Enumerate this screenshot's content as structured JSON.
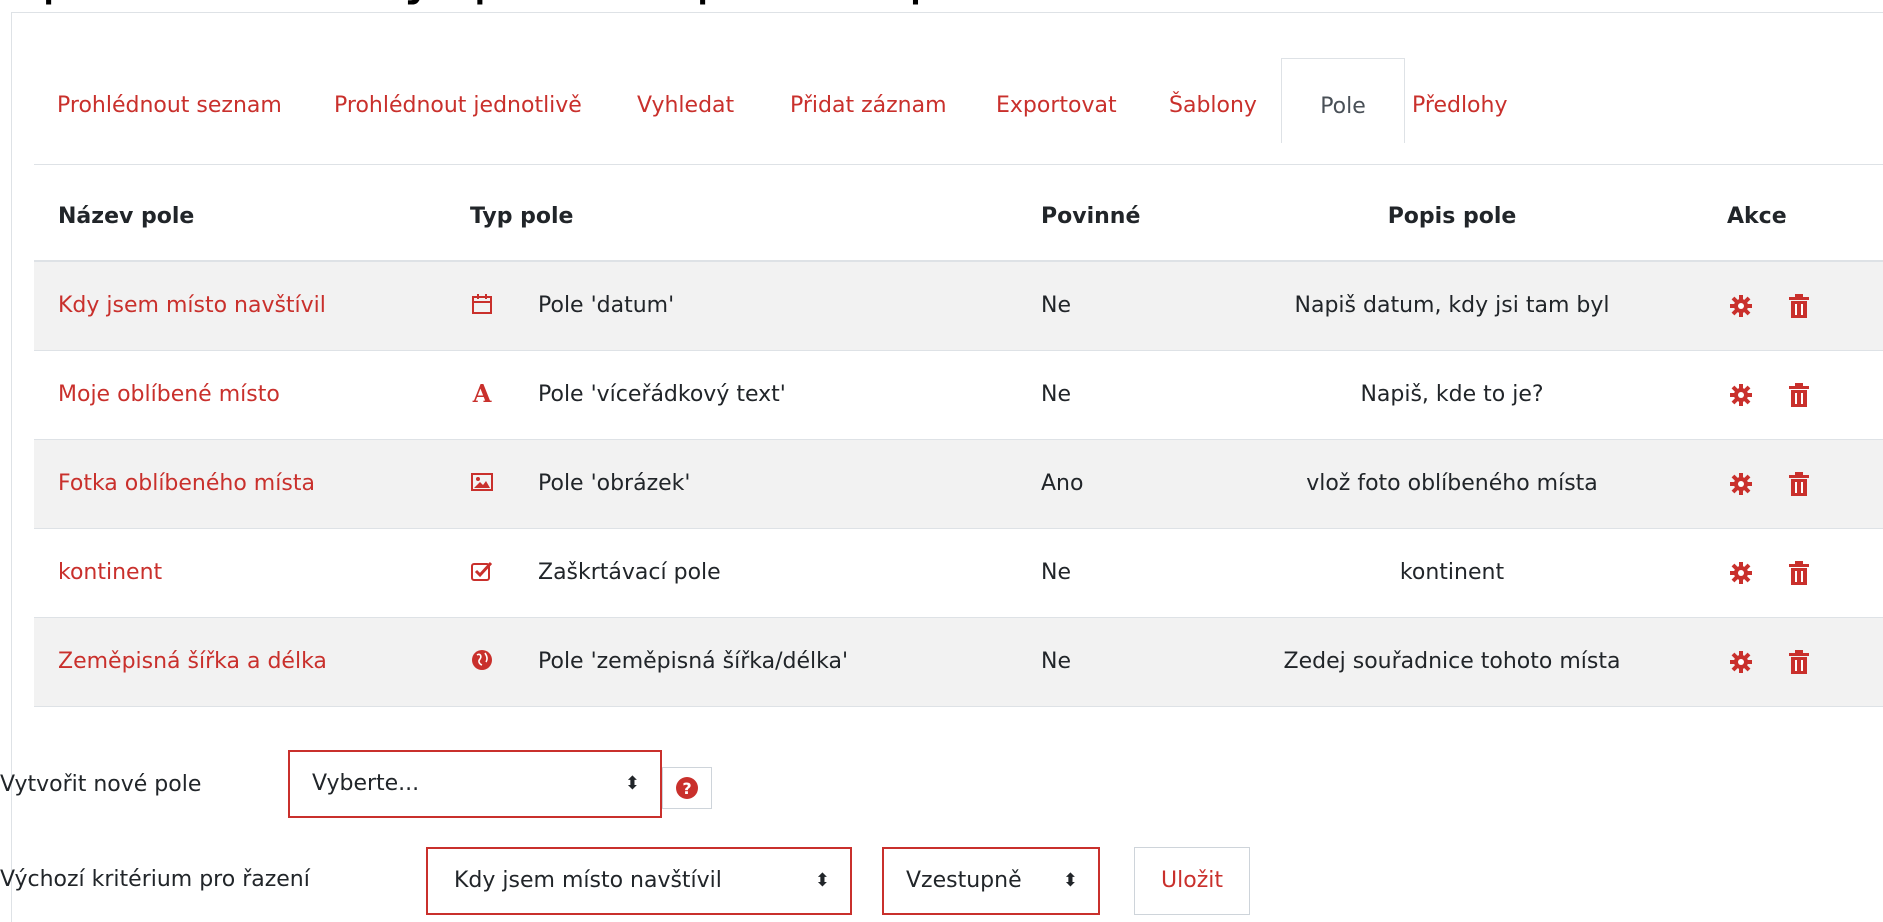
{
  "page_title_partial": "Úprava šablony, pomocí přidání polí",
  "tabs": [
    {
      "label": "Prohlédnout seznam"
    },
    {
      "label": "Prohlédnout jednotlivě"
    },
    {
      "label": "Vyhledat"
    },
    {
      "label": "Přidat záznam"
    },
    {
      "label": "Exportovat"
    },
    {
      "label": "Šablony"
    },
    {
      "label": "Pole",
      "active": true
    },
    {
      "label": "Předlohy"
    }
  ],
  "table": {
    "headers": {
      "name": "Název pole",
      "type": "Typ pole",
      "required": "Povinné",
      "description": "Popis pole",
      "actions": "Akce"
    },
    "rows": [
      {
        "name": "Kdy jsem místo navštívil",
        "type_icon": "calendar-icon",
        "type": "Pole 'datum'",
        "required": "Ne",
        "description": "Napiš datum, kdy jsi tam byl"
      },
      {
        "name": "Moje oblíbené místo",
        "type_icon": "text-font-icon",
        "type": "Pole 'víceřádkový text'",
        "required": "Ne",
        "description": "Napiš, kde to je?"
      },
      {
        "name": "Fotka oblíbeného místa",
        "type_icon": "image-icon",
        "type": "Pole 'obrázek'",
        "required": "Ano",
        "description": "vlož foto oblíbeného místa"
      },
      {
        "name": "kontinent",
        "type_icon": "checkbox-icon",
        "type": "Zaškrtávací pole",
        "required": "Ne",
        "description": "kontinent"
      },
      {
        "name": "Zeměpisná šířka a délka",
        "type_icon": "globe-icon",
        "type": "Pole 'zeměpisná šířka/délka'",
        "required": "Ne",
        "description": "Zedej souřadnice tohoto místa"
      }
    ],
    "action_icons": [
      "gear-icon",
      "trash-icon"
    ]
  },
  "new_field": {
    "label": "Vytvořit nové pole",
    "select_value": "Vyberte...",
    "help_icon": "question-circle-icon"
  },
  "sorting": {
    "label": "Výchozí kritérium pro řazení",
    "field_value": "Kdy jsem místo navštívil",
    "order_value": "Vzestupně",
    "save_label": "Uložit"
  },
  "colors": {
    "accent": "#c9302c",
    "row_stripe": "#f2f2f2",
    "border": "#dee2e6"
  }
}
